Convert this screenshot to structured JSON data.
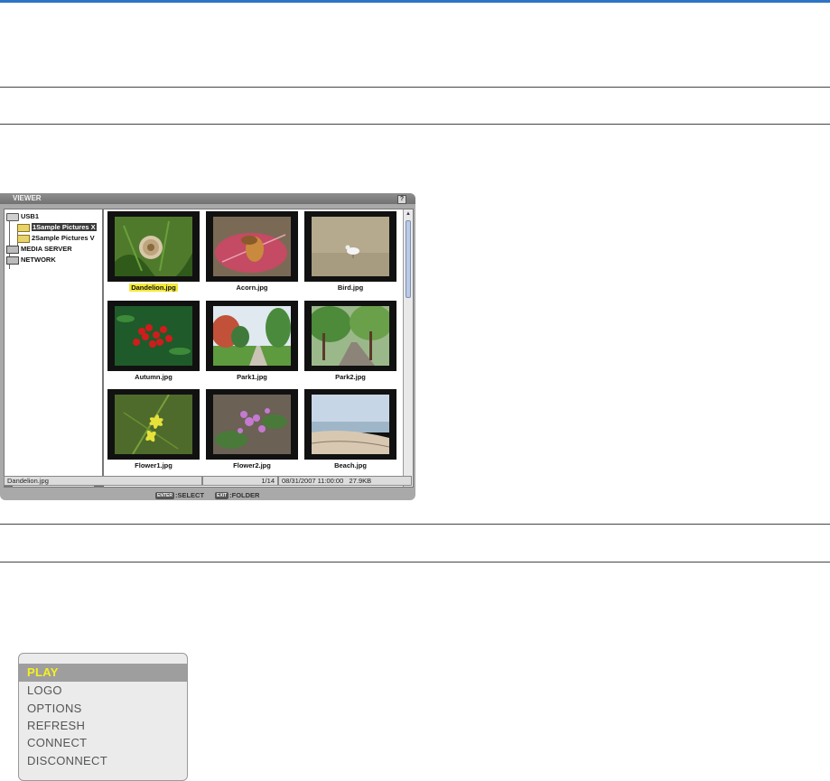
{
  "viewer": {
    "title": "VIEWER",
    "help_label": "?",
    "tree": [
      {
        "label": "USB1",
        "icon": "drive-icon"
      },
      {
        "label": "1Sample Pictures X",
        "icon": "folder-icon"
      },
      {
        "label": "2Sample Pictures V",
        "icon": "folder-icon"
      },
      {
        "label": "MEDIA SERVER",
        "icon": "server-icon"
      },
      {
        "label": "NETWORK",
        "icon": "network-icon"
      }
    ],
    "thumbnails": [
      {
        "name": "Dandelion.jpg"
      },
      {
        "name": "Acorn.jpg"
      },
      {
        "name": "Bird.jpg"
      },
      {
        "name": "Autumn.jpg"
      },
      {
        "name": "Park1.jpg"
      },
      {
        "name": "Park2.jpg"
      },
      {
        "name": "Flower1.jpg"
      },
      {
        "name": "Flower2.jpg"
      },
      {
        "name": "Beach.jpg"
      }
    ],
    "status": {
      "filename": "Dandelion.jpg",
      "position": "1/14",
      "datetime": "08/31/2007 11:00:00",
      "size": "27.9KB"
    },
    "hints": {
      "enter_key": "ENTER",
      "select": ":SELECT",
      "exit_key": "EXIT",
      "folder": ":FOLDER"
    }
  },
  "menu": {
    "items": [
      "PLAY",
      "LOGO",
      "OPTIONS",
      "REFRESH",
      "CONNECT",
      "DISCONNECT"
    ],
    "active_index": 0,
    "highlight_color": "#f7f01d"
  },
  "colors": {
    "accent_top_bar": "#2f74c4",
    "selection_highlight": "#f4ea3a"
  }
}
